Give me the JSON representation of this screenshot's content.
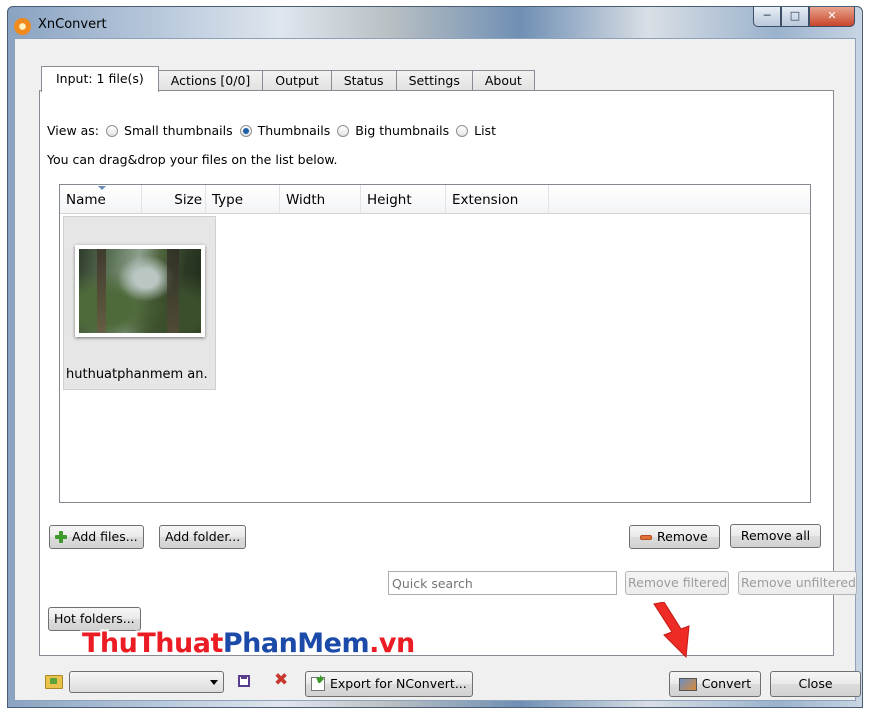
{
  "window": {
    "title": "XnConvert",
    "controls": [
      "minimize",
      "maximize",
      "close"
    ]
  },
  "tabs": [
    {
      "label": "Input: 1 file(s)",
      "active": true
    },
    {
      "label": "Actions [0/0]"
    },
    {
      "label": "Output"
    },
    {
      "label": "Status"
    },
    {
      "label": "Settings"
    },
    {
      "label": "About"
    }
  ],
  "view": {
    "label": "View as:",
    "options": [
      {
        "label": "Small thumbnails",
        "selected": false
      },
      {
        "label": "Thumbnails",
        "selected": true
      },
      {
        "label": "Big thumbnails",
        "selected": false
      },
      {
        "label": "List",
        "selected": false
      }
    ],
    "hint": "You can drag&drop your files on the list below."
  },
  "filelist": {
    "columns": [
      "Name",
      "Size",
      "Type",
      "Width",
      "Height",
      "Extension"
    ],
    "files": [
      {
        "name": "huthuatphanmem an."
      }
    ]
  },
  "buttons": {
    "add_files": "Add files...",
    "add_folder": "Add folder...",
    "remove": "Remove",
    "remove_all": "Remove all",
    "remove_filtered": "Remove filtered",
    "remove_unfiltered": "Remove unfiltered",
    "hot_folders": "Hot folders...",
    "export": "Export for NConvert...",
    "convert": "Convert",
    "close": "Close"
  },
  "search": {
    "placeholder": "Quick search",
    "value": ""
  },
  "icons": [
    "app-icon",
    "plus-icon",
    "minus-icon",
    "folder-icon",
    "save-icon",
    "delete-icon",
    "export-icon",
    "convert-icon",
    "arrow-icon"
  ],
  "watermark": {
    "part1": "ThuThuat",
    "part2": "PhanMem",
    "part3": ".vn"
  },
  "colors": {
    "watermark_red": "#ec1c24",
    "watermark_blue": "#1b4aa8",
    "annotation_arrow": "#ee2b24"
  }
}
